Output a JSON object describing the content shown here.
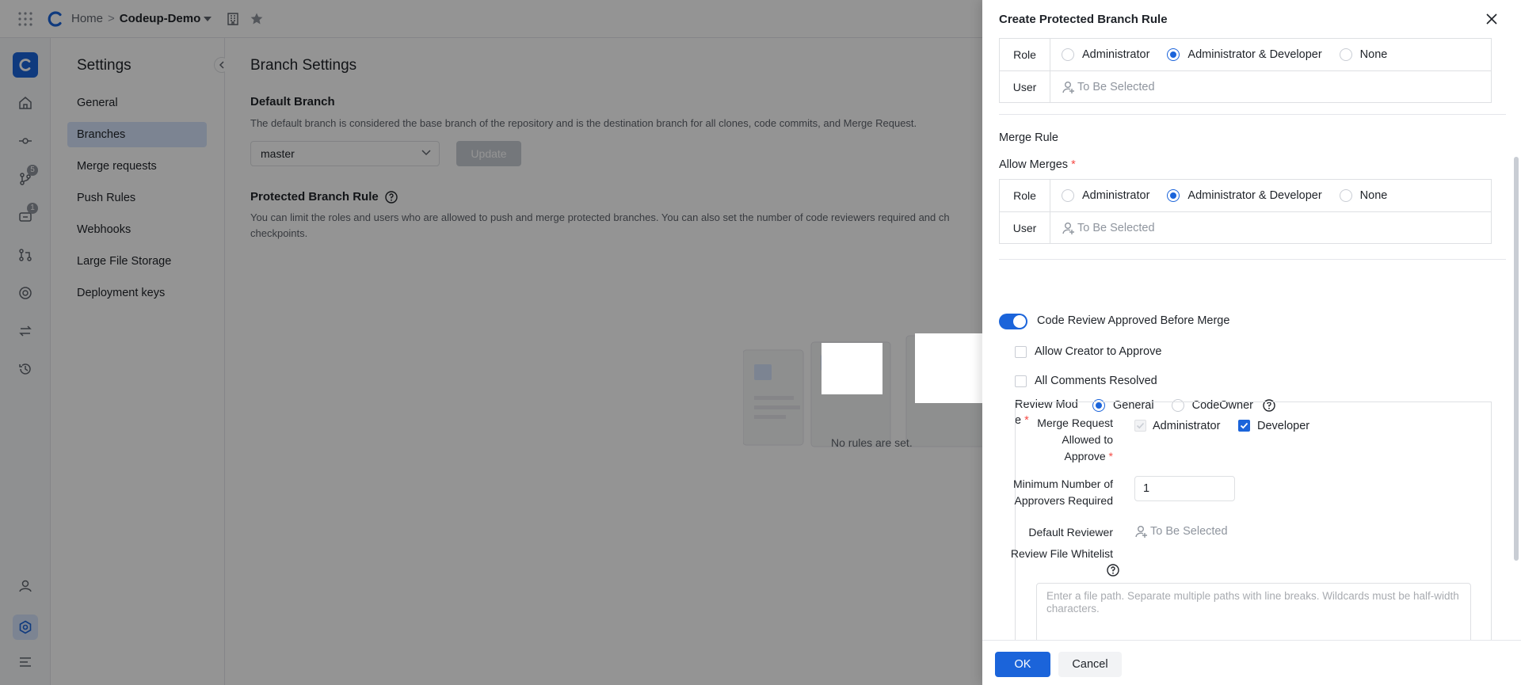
{
  "topbar": {
    "home": "Home",
    "separator": ">",
    "project": "Codeup-Demo"
  },
  "rail": {
    "badge_merge": "5",
    "badge_issues": "1"
  },
  "settings_nav": {
    "title": "Settings",
    "items": [
      "General",
      "Branches",
      "Merge requests",
      "Push Rules",
      "Webhooks",
      "Large File Storage",
      "Deployment keys"
    ],
    "active": "Branches"
  },
  "main": {
    "title": "Branch Settings",
    "default_branch": {
      "heading": "Default Branch",
      "description": "The default branch is considered the base branch of the repository and is the destination branch for all clones, code commits, and Merge Request.",
      "selected": "master",
      "update_label": "Update"
    },
    "protected": {
      "heading": "Protected Branch Rule",
      "description_1": "You can limit the roles and users who are allowed to push and merge protected branches. You can also set the number of code reviewers required and ch",
      "description_2": "checkpoints.",
      "empty": "No rules are set."
    }
  },
  "drawer": {
    "title": "Create Protected Branch Rule",
    "push_table": {
      "role_label": "Role",
      "user_label": "User",
      "options": [
        "Administrator",
        "Administrator & Developer",
        "None"
      ],
      "selected": "Administrator & Developer",
      "user_placeholder": "To Be Selected"
    },
    "merge_rule": {
      "heading": "Merge Rule",
      "allow_label": "Allow Merges",
      "required_mark": "*",
      "role_label": "Role",
      "user_label": "User",
      "options": [
        "Administrator",
        "Administrator & Developer",
        "None"
      ],
      "selected": "Administrator & Developer",
      "user_placeholder": "To Be Selected"
    },
    "code_review": {
      "toggle_label": "Code Review Approved Before Merge",
      "toggle_on": true,
      "allow_creator": "Allow Creator to Approve",
      "all_comments": "All Comments Resolved",
      "review_mode_label_1": "Review Mod",
      "review_mode_label_2": "e",
      "review_mode_options": [
        "General",
        "CodeOwner"
      ],
      "review_mode_selected": "General",
      "mr_allowed_label": [
        "Merge Request",
        "Allowed to",
        "Approve"
      ],
      "mr_allowed_options": [
        "Administrator",
        "Developer"
      ],
      "min_label": [
        "Minimum Number of",
        "Approvers Required"
      ],
      "min_value": "1",
      "default_reviewer_label": "Default Reviewer",
      "default_reviewer_placeholder": "To Be Selected",
      "whitelist_label": "Review File Whitelist",
      "whitelist_placeholder": "Enter a file path. Separate multiple paths with line breaks. Wildcards must be half-width characters."
    },
    "ok_label": "OK",
    "cancel_label": "Cancel"
  },
  "colors": {
    "accent": "#1b64da",
    "overlay": "rgba(0,0,0,0.42)"
  }
}
